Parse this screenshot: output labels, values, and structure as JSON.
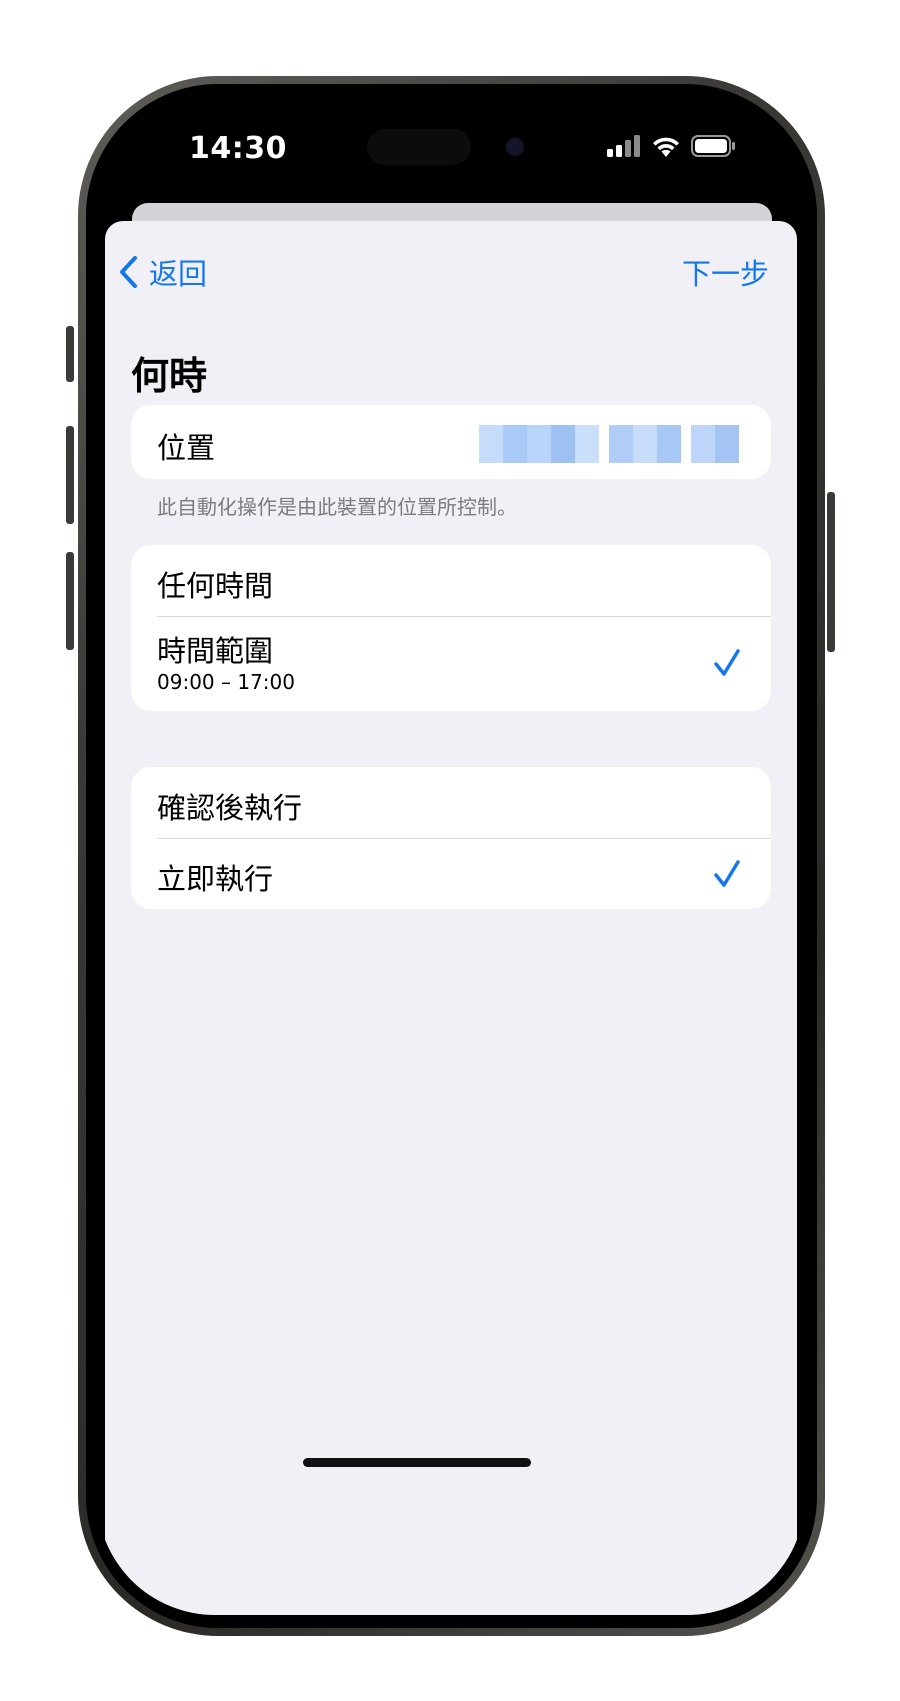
{
  "status_bar": {
    "time": "14:30",
    "signal_icon": "cellular-signal-icon",
    "wifi_icon": "wifi-icon",
    "battery_icon": "battery-icon"
  },
  "nav": {
    "back_label": "返回",
    "back_icon": "chevron-left-icon",
    "next_label": "下一步"
  },
  "section": {
    "title": "何時"
  },
  "location_card": {
    "label": "位置",
    "value_obscured": true,
    "footnote": "此自動化操作是由此裝置的位置所控制。"
  },
  "time_card": {
    "rows": [
      {
        "label": "任何時間",
        "checked": false
      },
      {
        "label": "時間範圍",
        "sublabel": "09:00 – 17:00",
        "checked": true
      }
    ]
  },
  "run_card": {
    "rows": [
      {
        "label": "確認後執行",
        "checked": false
      },
      {
        "label": "立即執行",
        "checked": true
      }
    ]
  },
  "colors": {
    "accent": "#1478ea",
    "sheet_bg": "#f1f0f6",
    "card_bg": "#ffffff",
    "footnote_text": "#7c7c80"
  }
}
